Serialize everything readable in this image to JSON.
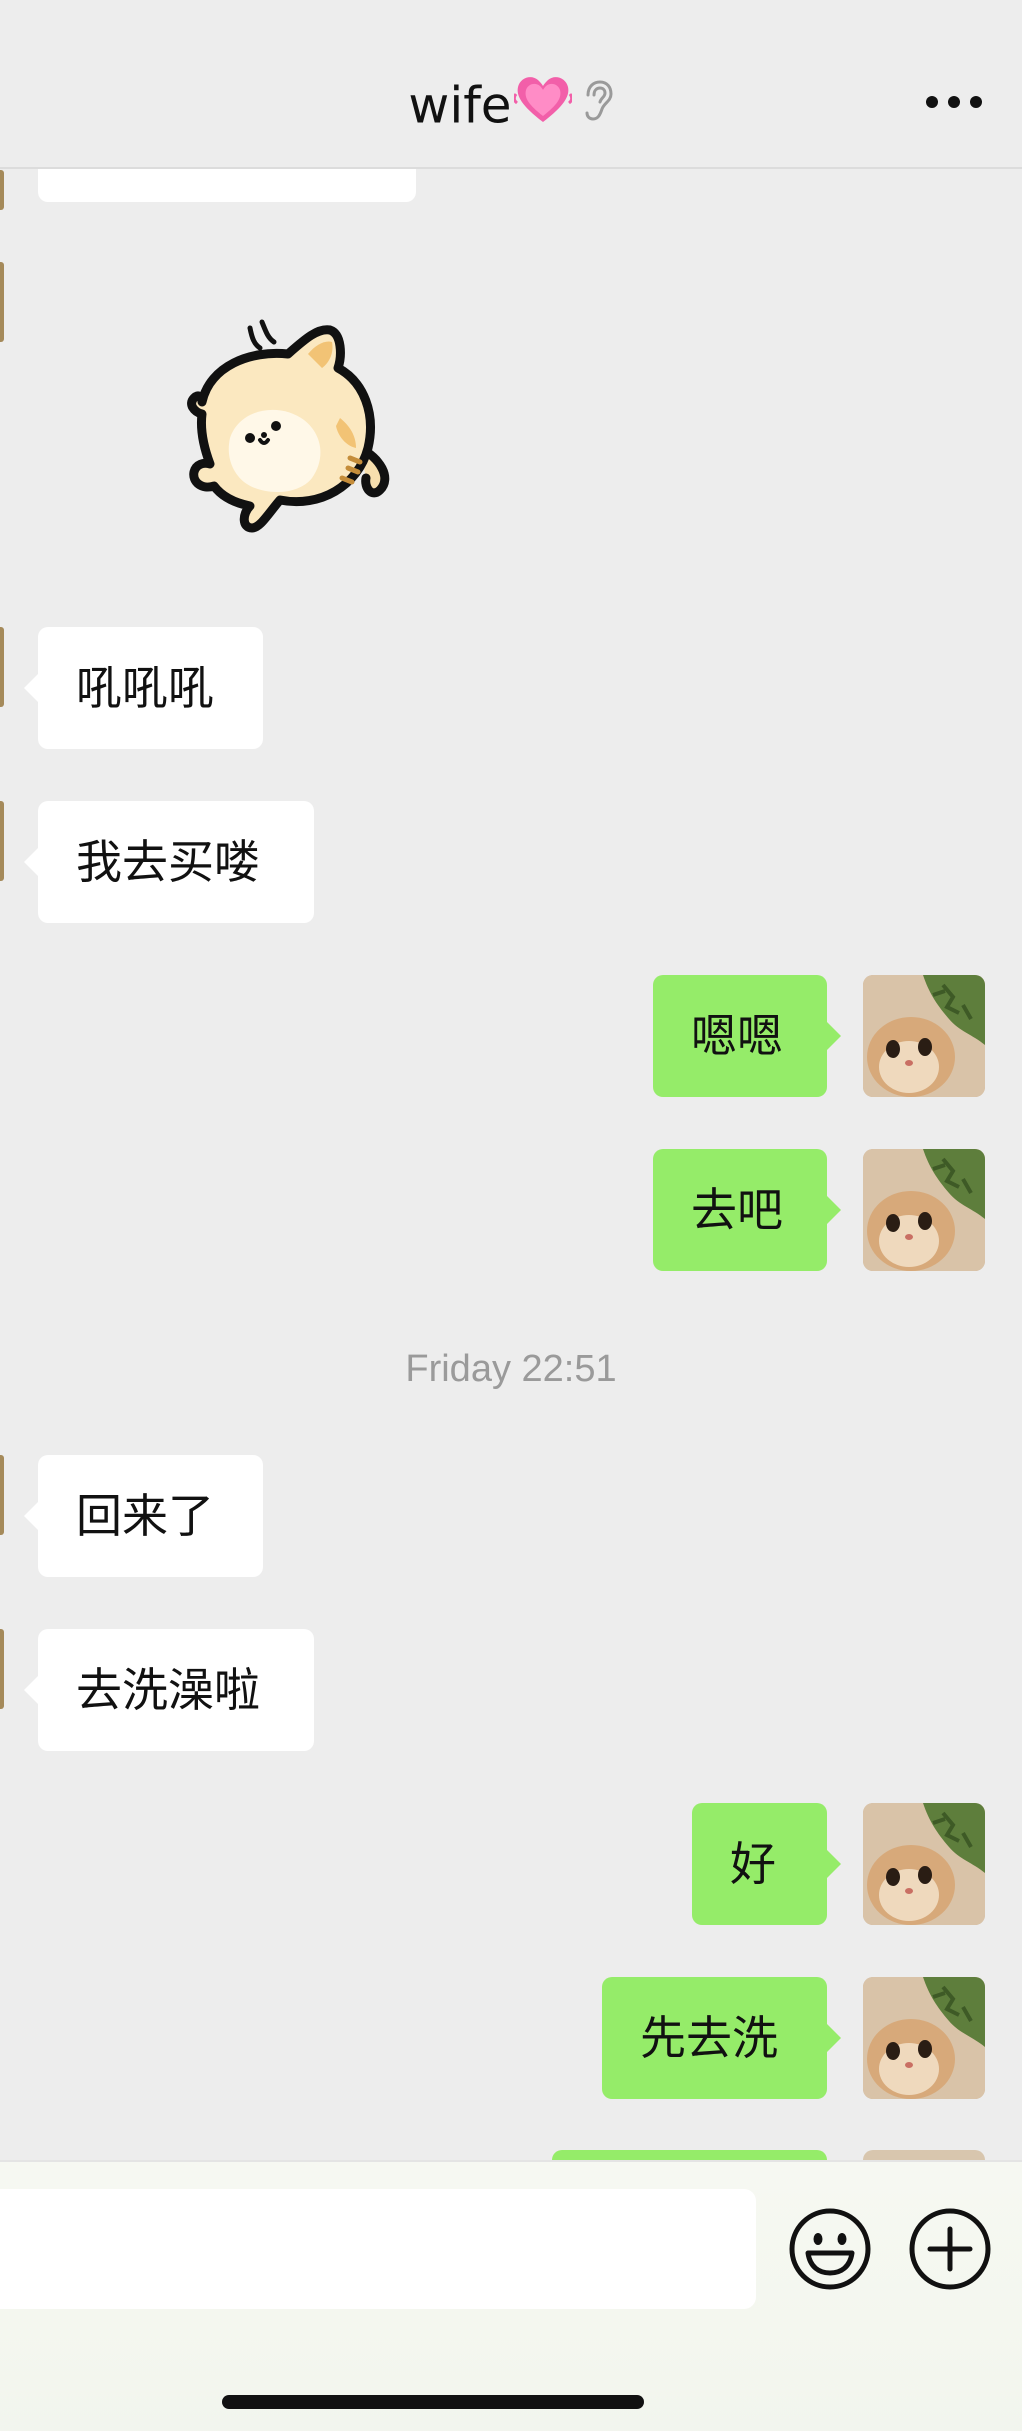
{
  "header": {
    "title": "wife",
    "heart_emoji": "heart-emoji-icon",
    "ear_icon": "ear-icon",
    "more_icon": "more-dots-icon"
  },
  "messages": [
    {
      "side": "in",
      "text": "吼吼吼"
    },
    {
      "side": "in",
      "text": "我去买喽"
    },
    {
      "side": "out",
      "text": "嗯嗯"
    },
    {
      "side": "out",
      "text": "去吧"
    },
    {
      "side": "in",
      "text": "回来了"
    },
    {
      "side": "in",
      "text": "去洗澡啦"
    },
    {
      "side": "out",
      "text": "好"
    },
    {
      "side": "out",
      "text": "先去洗"
    }
  ],
  "timestamp": "Friday 22:51",
  "sticker": {
    "name": "cat-sticker-icon"
  },
  "input": {
    "value": "",
    "placeholder": ""
  },
  "toolbar": {
    "emoji_icon": "emoji-icon",
    "plus_icon": "plus-icon"
  },
  "colors": {
    "background": "#ededed",
    "outgoing_bubble": "#95ec69",
    "incoming_bubble": "#ffffff",
    "timestamp_text": "#9a9a9a"
  }
}
